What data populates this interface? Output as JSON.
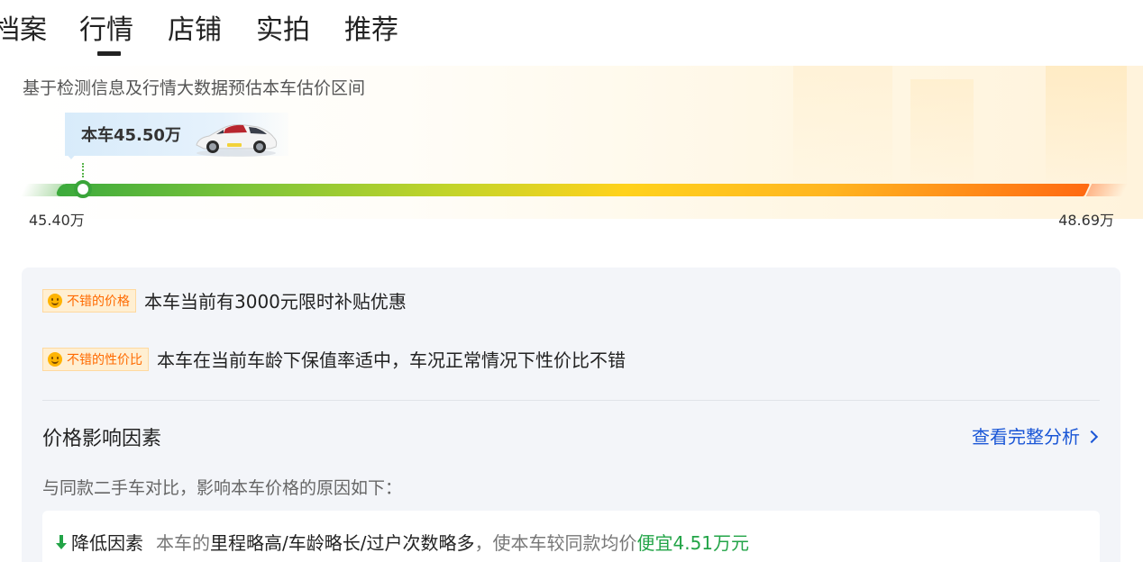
{
  "tabs": [
    {
      "label": "档案"
    },
    {
      "label": "行情",
      "active": true
    },
    {
      "label": "店铺"
    },
    {
      "label": "实拍"
    },
    {
      "label": "推荐"
    }
  ],
  "estimate": {
    "description": "基于检测信息及行情大数据预估本车估价区间",
    "car_price": "本车45.50万",
    "range_min": "45.40万",
    "range_max": "48.69万"
  },
  "tags": [
    {
      "label": "不错的价格",
      "text": "本车当前有3000元限时补贴优惠",
      "icon": "smile-icon"
    },
    {
      "label": "不错的性价比",
      "text": "本车在当前车龄下保值率适中，车况正常情况下性价比不错",
      "icon": "smile-icon"
    }
  ],
  "factors": {
    "title": "价格影响因素",
    "link": "查看完整分析",
    "subtitle": "与同款二手车对比，影响本车价格的原因如下：",
    "reason": {
      "label": "降低因素",
      "part_a": "本车的",
      "part_b": "里程略高/车龄略长/过户次数略多",
      "part_c": "，使本车较同款均价",
      "part_d": "便宜4.51万元"
    }
  },
  "colors": {
    "accent_link": "#1a56d6",
    "bar_start": "#3caa3c",
    "bar_end": "#ff6a12",
    "tag_text": "#ff6a00",
    "savings_green": "#22a447"
  }
}
